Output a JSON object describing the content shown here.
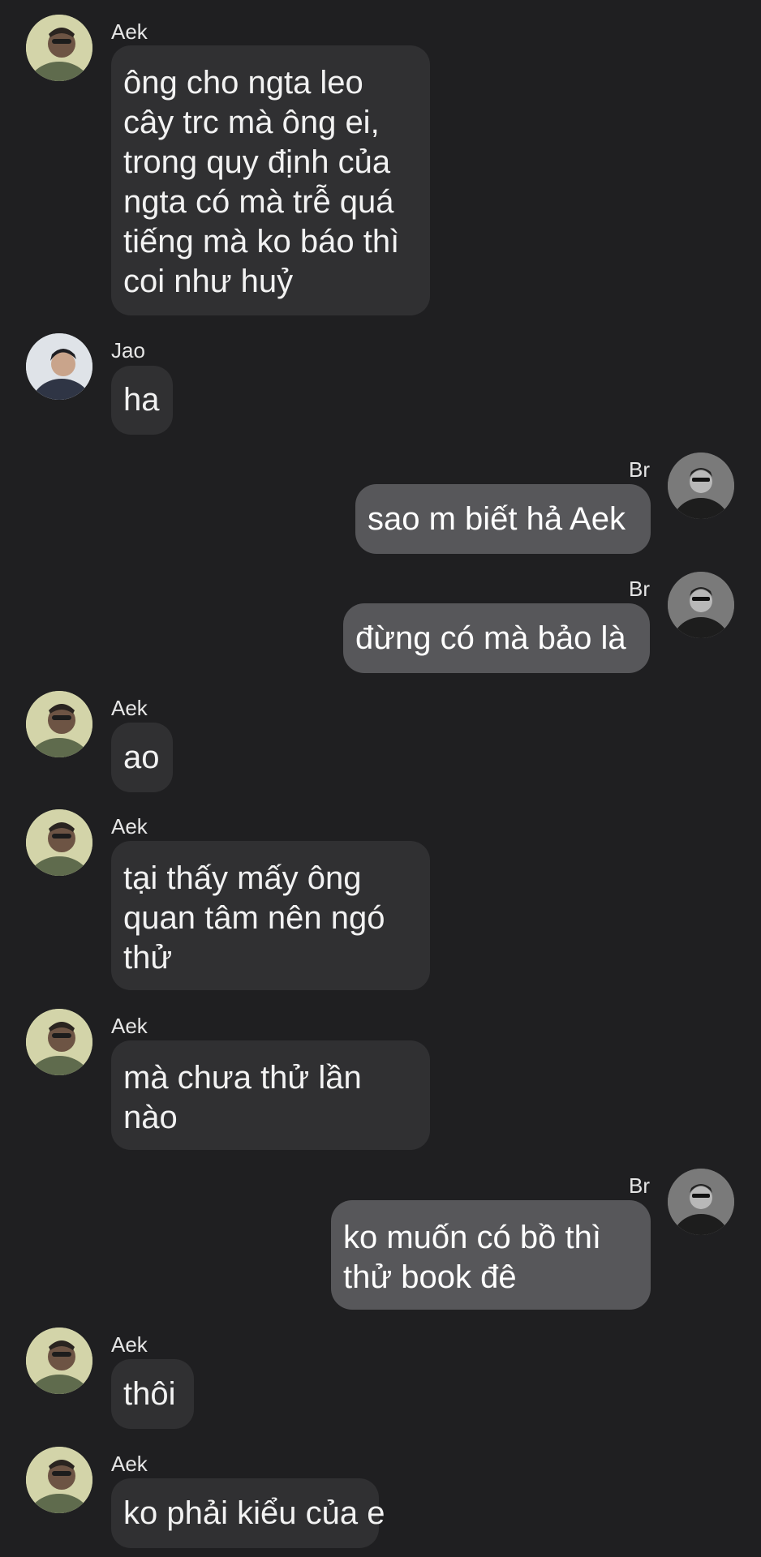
{
  "messages": [
    {
      "side": "in",
      "sender": "Aek",
      "avatar": "aek-avatar-icon",
      "text": "ông cho ngta leo\ncây trc mà ông ei,\ntrong quy định của\nngta có mà trễ quá\ntiếng mà ko báo thì\ncoi như huỷ"
    },
    {
      "side": "in",
      "sender": "Jao",
      "avatar": "jao-avatar-icon",
      "text": "ha"
    },
    {
      "side": "out",
      "sender": "Br",
      "avatar": "br-avatar-icon",
      "text": "sao m biết hả Aek"
    },
    {
      "side": "out",
      "sender": "Br",
      "avatar": "br-avatar-icon",
      "text": "đừng có mà bảo là"
    },
    {
      "side": "in",
      "sender": "Aek",
      "avatar": "aek-avatar-icon",
      "text": "ao"
    },
    {
      "side": "in",
      "sender": "Aek",
      "avatar": "aek-avatar-icon",
      "text": "tại thấy mấy ông\nquan tâm nên ngó\nthử"
    },
    {
      "side": "in",
      "sender": "Aek",
      "avatar": "aek-avatar-icon",
      "text": "mà chưa thử lần\nnào"
    },
    {
      "side": "out",
      "sender": "Br",
      "avatar": "br-avatar-icon",
      "text": "ko muốn có bồ thì\nthử book đê"
    },
    {
      "side": "in",
      "sender": "Aek",
      "avatar": "aek-avatar-icon",
      "text": "thôi"
    },
    {
      "side": "in",
      "sender": "Aek",
      "avatar": "aek-avatar-icon",
      "text": "ko phải kiểu của e"
    }
  ],
  "colors": {
    "background": "#1f1f21",
    "incoming_bubble": "#303032",
    "outgoing_bubble": "#57575a",
    "text": "#ffffff"
  }
}
